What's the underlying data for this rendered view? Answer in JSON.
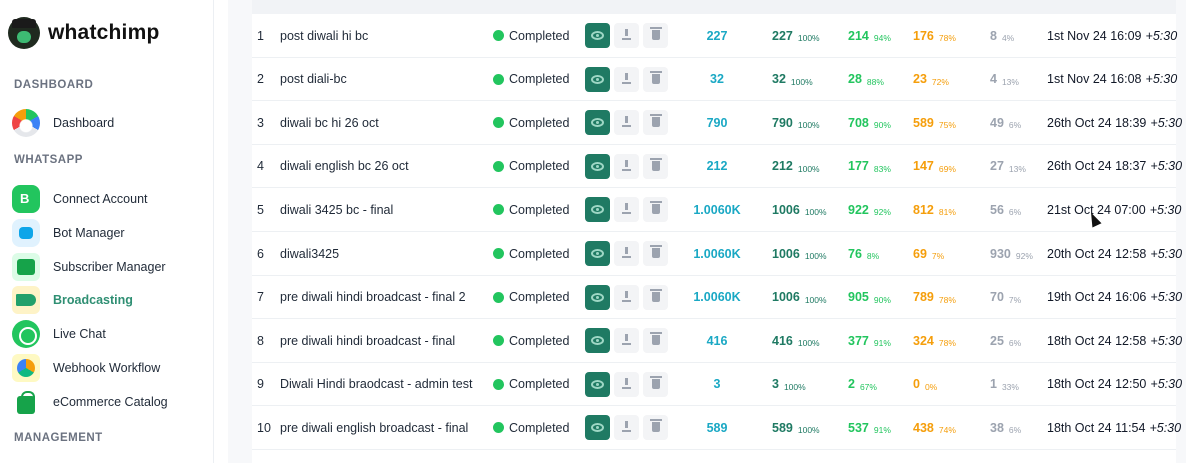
{
  "app": {
    "name": "whatchimp"
  },
  "sidebar": {
    "sections": [
      "DASHBOARD",
      "WHATSAPP",
      "MANAGEMENT"
    ],
    "items": [
      {
        "label": "Dashboard",
        "icon": "dashboard-gauge-icon"
      },
      {
        "label": "Connect Account",
        "icon": "whatsapp-business-icon"
      },
      {
        "label": "Bot Manager",
        "icon": "robot-icon"
      },
      {
        "label": "Subscriber Manager",
        "icon": "subscribers-icon"
      },
      {
        "label": "Broadcasting",
        "icon": "megaphone-icon",
        "active": true
      },
      {
        "label": "Live Chat",
        "icon": "chat-icon"
      },
      {
        "label": "Webhook Workflow",
        "icon": "webhook-icon"
      },
      {
        "label": "eCommerce Catalog",
        "icon": "shopping-bag-icon"
      }
    ]
  },
  "broadcasts": {
    "rows": [
      {
        "num": "1",
        "name": "post diwali hi bc",
        "status": "Completed",
        "total": "227",
        "sent": "227",
        "sent_pct": "100%",
        "delivered": "214",
        "delivered_pct": "94%",
        "read": "176",
        "read_pct": "78%",
        "failed": "8",
        "failed_pct": "4%",
        "date": "1st Nov 24 16:09",
        "tz": "+5:30"
      },
      {
        "num": "2",
        "name": "post diali-bc",
        "status": "Completed",
        "total": "32",
        "sent": "32",
        "sent_pct": "100%",
        "delivered": "28",
        "delivered_pct": "88%",
        "read": "23",
        "read_pct": "72%",
        "failed": "4",
        "failed_pct": "13%",
        "date": "1st Nov 24 16:08",
        "tz": "+5:30"
      },
      {
        "num": "3",
        "name": "diwali bc hi 26 oct",
        "status": "Completed",
        "total": "790",
        "sent": "790",
        "sent_pct": "100%",
        "delivered": "708",
        "delivered_pct": "90%",
        "read": "589",
        "read_pct": "75%",
        "failed": "49",
        "failed_pct": "6%",
        "date": "26th Oct 24 18:39",
        "tz": "+5:30"
      },
      {
        "num": "4",
        "name": "diwali english bc 26 oct",
        "status": "Completed",
        "total": "212",
        "sent": "212",
        "sent_pct": "100%",
        "delivered": "177",
        "delivered_pct": "83%",
        "read": "147",
        "read_pct": "69%",
        "failed": "27",
        "failed_pct": "13%",
        "date": "26th Oct 24 18:37",
        "tz": "+5:30"
      },
      {
        "num": "5",
        "name": "diwali 3425 bc - final",
        "status": "Completed",
        "total": "1.0060K",
        "sent": "1006",
        "sent_pct": "100%",
        "delivered": "922",
        "delivered_pct": "92%",
        "read": "812",
        "read_pct": "81%",
        "failed": "56",
        "failed_pct": "6%",
        "date": "21st Oct 24 07:00",
        "tz": "+5:30"
      },
      {
        "num": "6",
        "name": "diwali3425",
        "status": "Completed",
        "total": "1.0060K",
        "sent": "1006",
        "sent_pct": "100%",
        "delivered": "76",
        "delivered_pct": "8%",
        "read": "69",
        "read_pct": "7%",
        "failed": "930",
        "failed_pct": "92%",
        "date": "20th Oct 24 12:58",
        "tz": "+5:30"
      },
      {
        "num": "7",
        "name": "pre diwali hindi broadcast - final 2",
        "status": "Completed",
        "total": "1.0060K",
        "sent": "1006",
        "sent_pct": "100%",
        "delivered": "905",
        "delivered_pct": "90%",
        "read": "789",
        "read_pct": "78%",
        "failed": "70",
        "failed_pct": "7%",
        "date": "19th Oct 24 16:06",
        "tz": "+5:30"
      },
      {
        "num": "8",
        "name": "pre diwali hindi broadcast - final",
        "status": "Completed",
        "total": "416",
        "sent": "416",
        "sent_pct": "100%",
        "delivered": "377",
        "delivered_pct": "91%",
        "read": "324",
        "read_pct": "78%",
        "failed": "25",
        "failed_pct": "6%",
        "date": "18th Oct 24 12:58",
        "tz": "+5:30"
      },
      {
        "num": "9",
        "name": "Diwali Hindi braodcast - admin test",
        "status": "Completed",
        "total": "3",
        "sent": "3",
        "sent_pct": "100%",
        "delivered": "2",
        "delivered_pct": "67%",
        "read": "0",
        "read_pct": "0%",
        "failed": "1",
        "failed_pct": "33%",
        "date": "18th Oct 24 12:50",
        "tz": "+5:30"
      },
      {
        "num": "10",
        "name": "pre diwali english broadcast - final",
        "status": "Completed",
        "total": "589",
        "sent": "589",
        "sent_pct": "100%",
        "delivered": "537",
        "delivered_pct": "91%",
        "read": "438",
        "read_pct": "74%",
        "failed": "38",
        "failed_pct": "6%",
        "date": "18th Oct 24 11:54",
        "tz": "+5:30"
      }
    ]
  },
  "colors": {
    "brand_green": "#1f7a63",
    "total": "#1aa8c4",
    "delivered": "#22c55e",
    "read": "#f59e0b",
    "failed": "#9ca3af",
    "status_completed": "#22c55e"
  }
}
